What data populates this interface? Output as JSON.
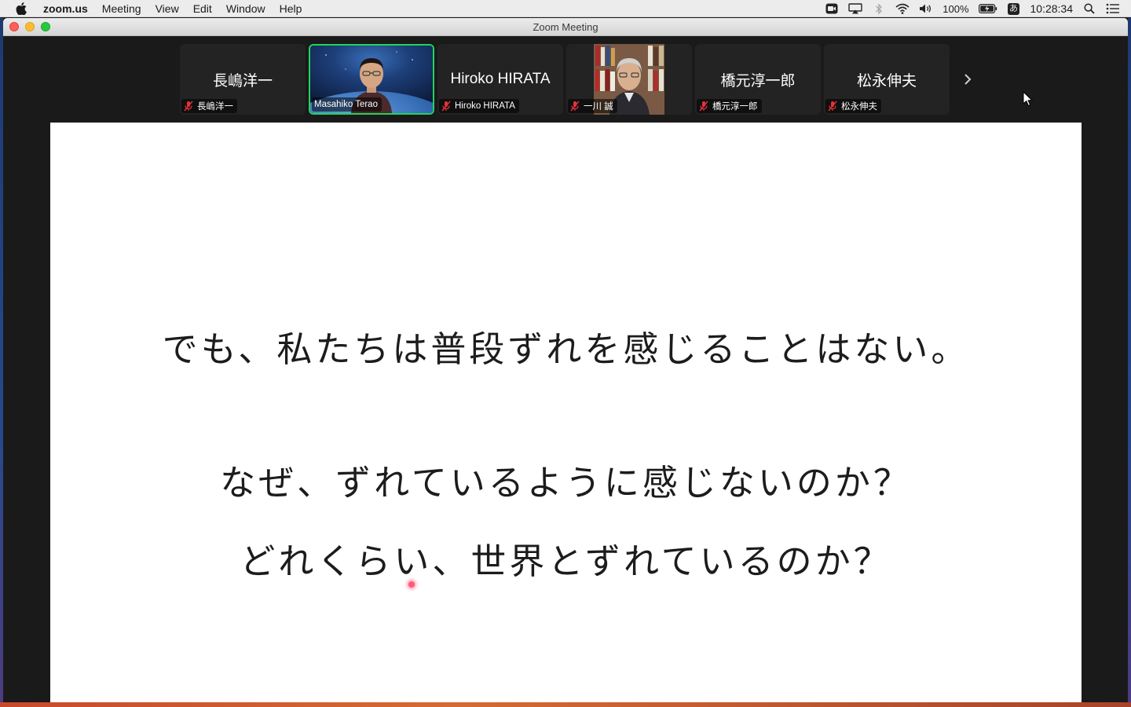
{
  "menubar": {
    "app_name": "zoom.us",
    "items": [
      "Meeting",
      "View",
      "Edit",
      "Window",
      "Help"
    ],
    "battery": "100%",
    "input_method": "あ",
    "clock": "10:28:34"
  },
  "window": {
    "title": "Zoom Meeting"
  },
  "participants": [
    {
      "display": "長嶋洋一",
      "label": "長嶋洋一",
      "muted": true,
      "video": false
    },
    {
      "display": "",
      "label": "Masahiko Terao",
      "muted": false,
      "video": true,
      "active": true
    },
    {
      "display": "Hiroko HIRATA",
      "label": "Hiroko HIRATA",
      "muted": true,
      "video": false
    },
    {
      "display": "",
      "label": "一川 誠",
      "muted": true,
      "video": true
    },
    {
      "display": "橋元淳一郎",
      "label": "橋元淳一郎",
      "muted": true,
      "video": false
    },
    {
      "display": "松永伸夫",
      "label": "松永伸夫",
      "muted": true,
      "video": false
    }
  ],
  "slide": {
    "line1": "でも、私たちは普段ずれを感じることはない。",
    "line2": "なぜ、ずれているように感じないのか？",
    "line3": "どれくらい、世界とずれているのか？"
  },
  "colors": {
    "active_speaker": "#23d35a",
    "mute_icon": "#e8313a",
    "window_bg": "#1a1a1a",
    "slide_bg": "#ffffff"
  }
}
